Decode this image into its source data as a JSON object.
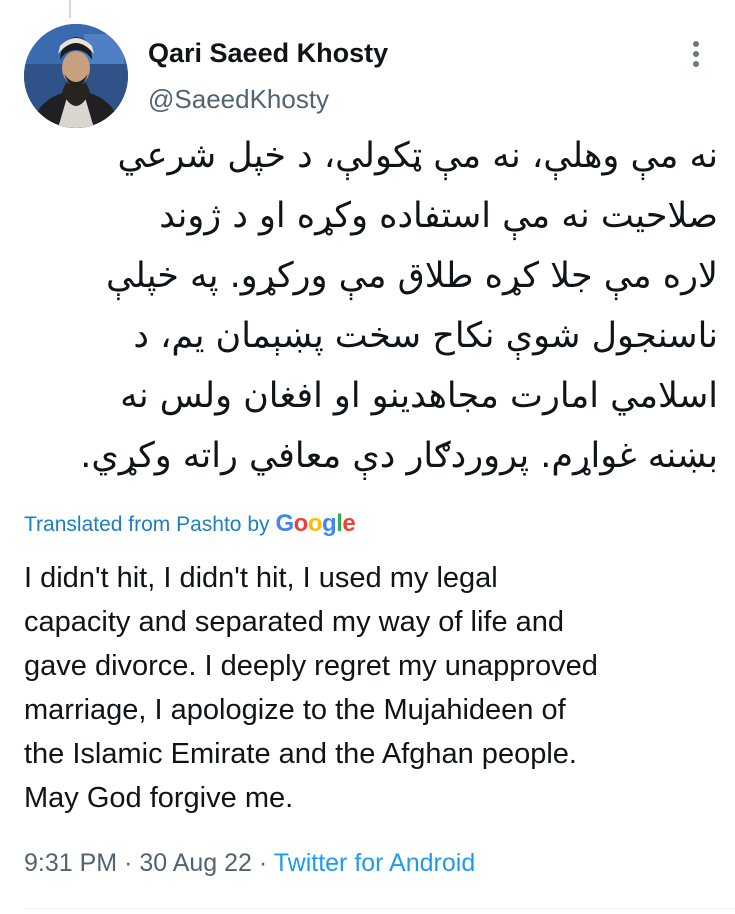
{
  "tweet": {
    "author": {
      "display_name": "Qari Saeed Khosty",
      "handle": "@SaeedKhosty"
    },
    "original_lines": [
      "نه مې وهلې، نه مې ټکولې، د خپل شرعي",
      "صلاحیت نه مې استفاده وکړه او د ژوند",
      "لاره مې جلا کړه طلاق مې ورکړو. په خپلې",
      "ناسنجول شوې نکاح سخت پښېمان یم، د",
      "اسلامي امارت مجاهدینو او افغان ولس نه",
      "بښنه غواړم. پروردګار دې معافي راته وکړي."
    ],
    "translated_label": "Translated from Pashto by",
    "translator": "Google",
    "translation_lines": [
      "I didn't hit, I didn't hit, I used my legal",
      "capacity and separated my way of life and",
      "gave divorce. I deeply regret my unapproved",
      "marriage, I apologize to the Mujahideen of",
      "the Islamic Emirate and the Afghan people.",
      "May God forgive me."
    ],
    "time": "9:31 PM",
    "date": "30 Aug 22",
    "separator": "·",
    "source": "Twitter for Android"
  },
  "icons": {
    "more": "more-vertical-icon",
    "avatar": "profile-photo"
  },
  "colors": {
    "link": "#1d9bf0",
    "secondary_text": "#536471",
    "primary_text": "#0f1419",
    "translate_link": "#1d7fbd"
  }
}
